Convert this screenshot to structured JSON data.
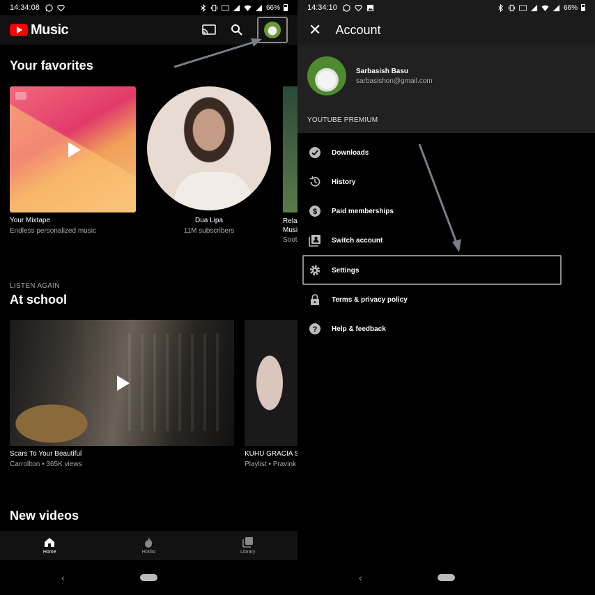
{
  "left": {
    "status": {
      "time": "14:34:08",
      "battery": "66%"
    },
    "app_name": "Music",
    "favorites": {
      "title": "Your favorites",
      "cards": [
        {
          "title": "Your Mixtape",
          "subtitle": "Endless personalized music"
        },
        {
          "title": "Dua Lipa",
          "subtitle": "11M subscribers"
        },
        {
          "title": "Relax Music",
          "subtitle": "Soot"
        }
      ]
    },
    "listen_again": {
      "kicker": "LISTEN AGAIN",
      "title": "At school",
      "cards": [
        {
          "title": "Scars To Your Beautiful",
          "subtitle": "Carrollton • 365K views"
        },
        {
          "title": "KUHU GRACIA S",
          "subtitle": "Playlist • Pravink"
        }
      ]
    },
    "new_videos": {
      "title": "New videos"
    },
    "nav": [
      {
        "label": "Home",
        "icon": "home-icon"
      },
      {
        "label": "Hotlist",
        "icon": "flame-icon"
      },
      {
        "label": "Library",
        "icon": "library-icon"
      }
    ]
  },
  "right": {
    "status": {
      "time": "14:34:10",
      "battery": "66%"
    },
    "title": "Account",
    "profile": {
      "name": "Sarbasish Basu",
      "email": "sarbasishon@gmail.com"
    },
    "premium_label": "YOUTUBE PREMIUM",
    "menu": [
      {
        "label": "Downloads",
        "icon": "download-check-icon"
      },
      {
        "label": "History",
        "icon": "history-icon"
      },
      {
        "label": "Paid memberships",
        "icon": "dollar-icon"
      },
      {
        "label": "Switch account",
        "icon": "switch-account-icon"
      },
      {
        "label": "Settings",
        "icon": "gear-icon"
      },
      {
        "label": "Terms & privacy policy",
        "icon": "lock-icon"
      },
      {
        "label": "Help & feedback",
        "icon": "help-icon"
      }
    ]
  }
}
